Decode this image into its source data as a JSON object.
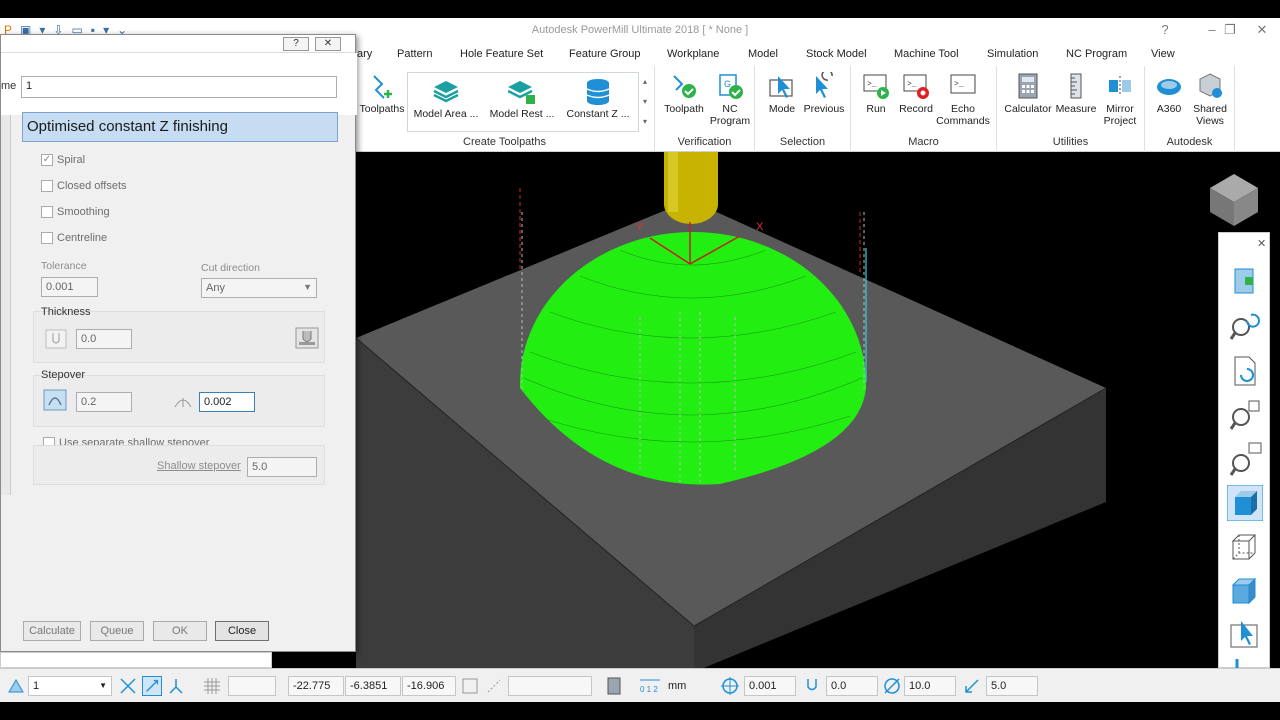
{
  "app": {
    "title": "Autodesk PowerMill Ultimate 2018   [ * None ]",
    "help_glyph": "?",
    "minimize_glyph": "–",
    "restore_glyph": "❐",
    "close_glyph": "✕"
  },
  "tabs": [
    "ary",
    "Pattern",
    "Hole Feature Set",
    "Feature Group",
    "Workplane",
    "Model",
    "Stock Model",
    "Machine Tool",
    "Simulation",
    "NC Program",
    "View"
  ],
  "ribbon": {
    "create_toolpaths": {
      "label": "Create Toolpaths",
      "toolpaths": "Toolpaths",
      "items": [
        "Model Area ...",
        "Model Rest ...",
        "Constant Z ..."
      ]
    },
    "verification": {
      "label": "Verification",
      "toolpath": "Toolpath",
      "nc_program": "NC Program"
    },
    "selection": {
      "label": "Selection",
      "mode": "Mode",
      "previous": "Previous"
    },
    "macro": {
      "label": "Macro",
      "run": "Run",
      "record": "Record",
      "echo": "Echo Commands"
    },
    "utilities": {
      "label": "Utilities",
      "calculator": "Calculator",
      "measure": "Measure",
      "mirror": "Mirror Project"
    },
    "autodesk": {
      "label": "Autodesk",
      "a360": "A360",
      "shared": "Shared Views"
    }
  },
  "dialog": {
    "help": "?",
    "close": "✕",
    "name_label": "me",
    "name_value": "1",
    "strategy_title": "Optimised constant Z finishing",
    "spiral": "Spiral",
    "closed_offsets": "Closed offsets",
    "smoothing": "Smoothing",
    "centreline": "Centreline",
    "tolerance_label": "Tolerance",
    "tolerance_value": "0.001",
    "cut_direction_label": "Cut direction",
    "cut_direction_value": "Any",
    "thickness_label": "Thickness",
    "thickness_value": "0.0",
    "stepover_label": "Stepover",
    "stepover_value": "0.2",
    "stepover_cusp_value": "0.002",
    "separate_shallow": "Use separate shallow stepover",
    "shallow_stepover_label": "Shallow stepover",
    "shallow_stepover_value": "5.0",
    "buttons": {
      "calculate": "Calculate",
      "queue": "Queue",
      "ok": "OK",
      "close": "Close"
    }
  },
  "statusbar": {
    "workplane": "1",
    "x": "-22.775",
    "y": "-6.3851",
    "z": "-16.906",
    "units": "mm",
    "tolerance": "0.001",
    "thickness": "0.0",
    "diameter": "10.0",
    "stepdown": "5.0"
  },
  "viewport": {
    "axis_x": "X",
    "axis_y": "Y",
    "toolpath_color": "#22ee11",
    "block_top_color": "#5a5a5a",
    "block_side_color": "#3e3e3e",
    "tool_color": "#c8b400"
  },
  "right_toolbar": {
    "close": "✕"
  }
}
